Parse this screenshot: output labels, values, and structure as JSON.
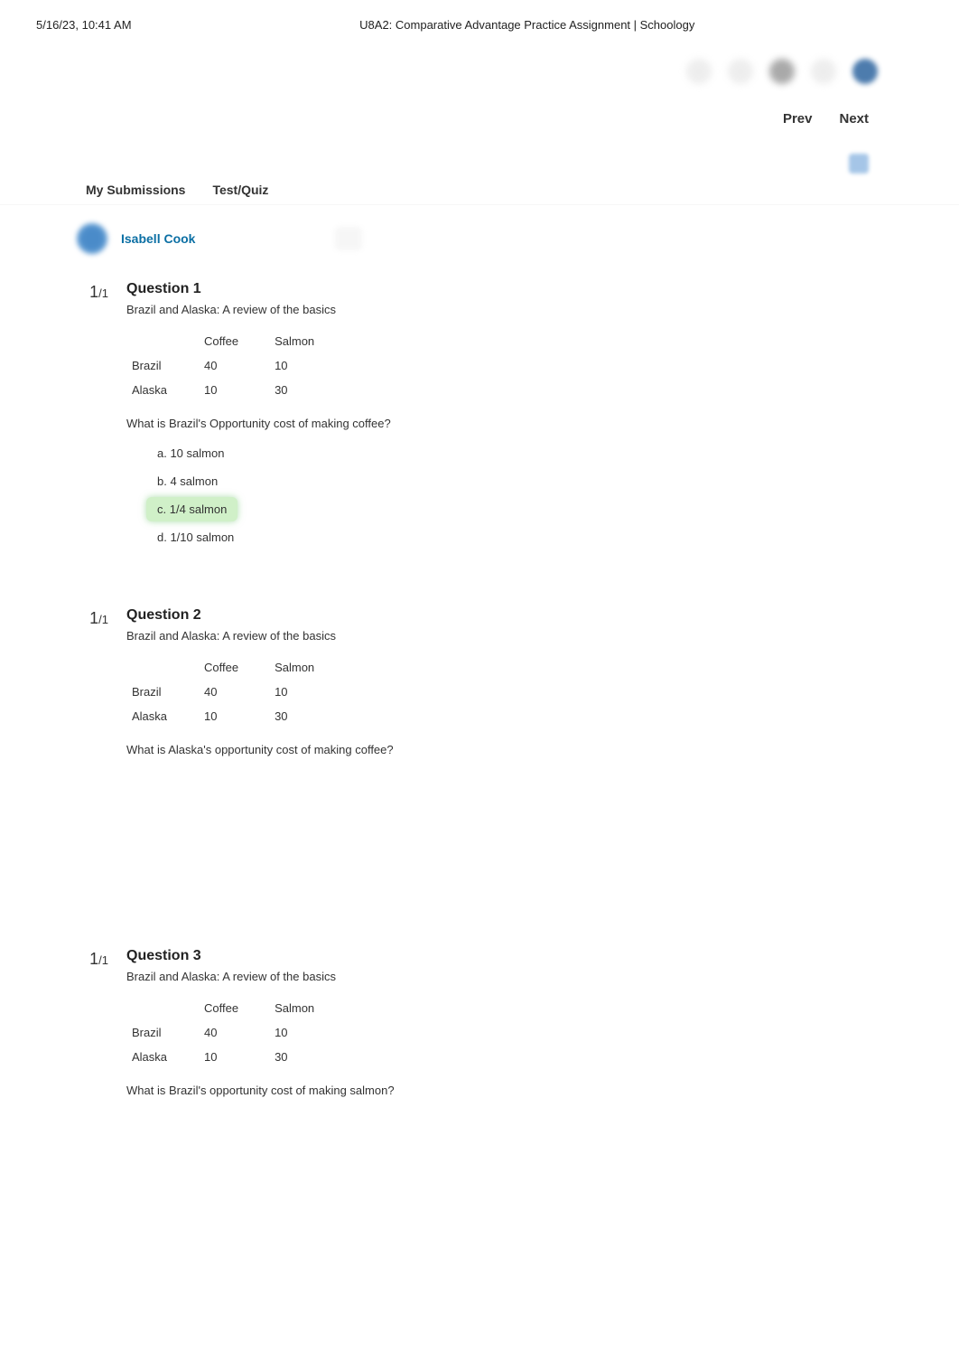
{
  "print_header": {
    "datetime": "5/16/23, 10:41 AM",
    "title": "U8A2: Comparative Advantage Practice Assignment | Schoology"
  },
  "nav": {
    "prev": "Prev",
    "next": "Next"
  },
  "tabs": {
    "my_submissions": "My Submissions",
    "test_quiz": "Test/Quiz"
  },
  "student": {
    "name": "Isabell Cook"
  },
  "table_headers": {
    "col1": "Coffee",
    "col2": "Salmon"
  },
  "table_rows": [
    {
      "label": "Brazil",
      "coffee": "40",
      "salmon": "10"
    },
    {
      "label": "Alaska",
      "coffee": "10",
      "salmon": "30"
    }
  ],
  "questions": [
    {
      "score_earned": "1",
      "score_total": "/1",
      "title": "Question 1",
      "subtitle": "Brazil and Alaska: A review of the basics",
      "prompt": "What is Brazil's Opportunity cost of making coffee?",
      "options": [
        {
          "text": "a. 10 salmon",
          "correct": false
        },
        {
          "text": "b. 4 salmon",
          "correct": false
        },
        {
          "text": "c. 1/4 salmon",
          "correct": true
        },
        {
          "text": "d. 1/10 salmon",
          "correct": false
        }
      ]
    },
    {
      "score_earned": "1",
      "score_total": "/1",
      "title": "Question 2",
      "subtitle": "Brazil and Alaska: A review of the basics",
      "prompt": "What is Alaska's opportunity cost of making coffee?",
      "options": []
    },
    {
      "score_earned": "1",
      "score_total": "/1",
      "title": "Question 3",
      "subtitle": "Brazil and Alaska: A review of the basics",
      "prompt": "What is Brazil's opportunity cost of making salmon?",
      "options": []
    }
  ]
}
